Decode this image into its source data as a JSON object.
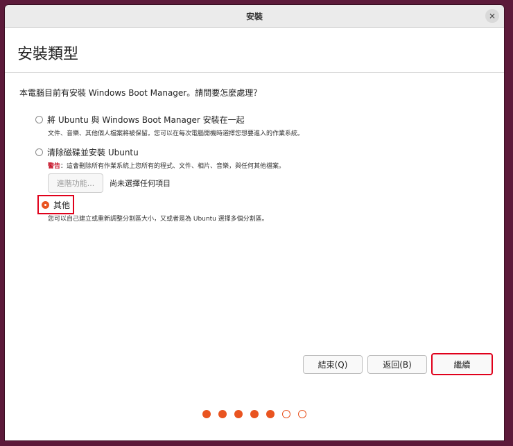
{
  "window": {
    "title": "安裝",
    "close_symbol": "×"
  },
  "header": {
    "title": "安裝類型"
  },
  "question": "本電腦目前有安裝 Windows Boot Manager。請問要怎麼處理？",
  "options": [
    {
      "label": "將 Ubuntu 與 Windows Boot Manager 安裝在一起",
      "description": "文件、音樂、其他個人檔案將被保留。您可以在每次電腦開機時選擇您想要進入的作業系統。",
      "checked": false
    },
    {
      "label": "清除磁碟並安裝 Ubuntu",
      "warning_prefix": "警告",
      "description": "：這會刪除所有作業系統上您所有的程式、文件、相片、音樂，與任何其他檔案。",
      "checked": false,
      "advanced_button": "進階功能...",
      "advanced_status": "尚未選擇任何項目"
    },
    {
      "label": "其他",
      "description": "您可以自己建立或重新調整分割區大小，又或者是為 Ubuntu 選擇多個分割區。",
      "checked": true
    }
  ],
  "buttons": {
    "quit": "結束(Q)",
    "back": "返回(B)",
    "continue": "繼續"
  },
  "progress": {
    "total_steps": 7,
    "completed_steps": 5
  },
  "colors": {
    "accent": "#e95420",
    "highlight": "#e0001b",
    "background": "#5c1a3a"
  }
}
